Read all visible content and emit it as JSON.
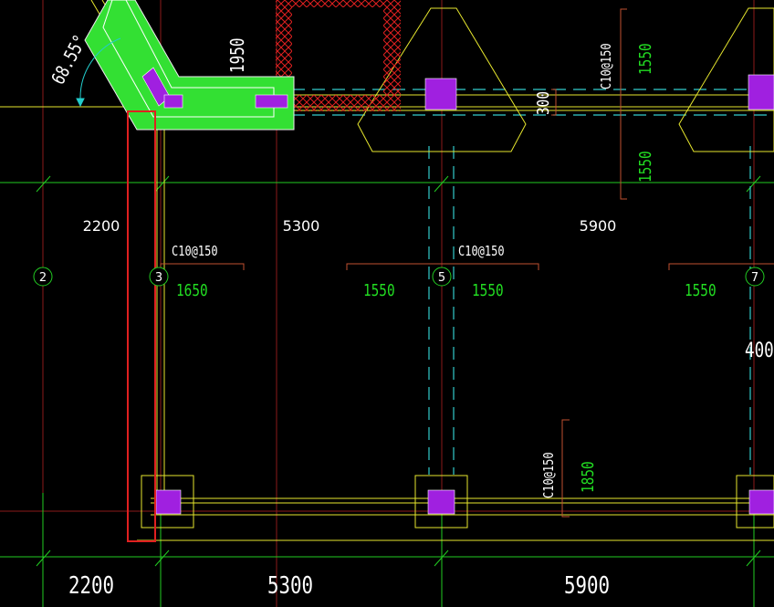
{
  "drawing": {
    "angle_label": "68.55°",
    "dims_top": {
      "d1950": "1950",
      "d300": "300",
      "d1550_upper": "1550",
      "d1550_lower": "1550"
    },
    "spans_upper": {
      "s1": "2200",
      "s2": "5300",
      "s3": "5900"
    },
    "spans_bottom": {
      "s1": "2200",
      "s2": "5300",
      "s3": "5900"
    },
    "rebar_labels": {
      "r1": "C10@150",
      "r2": "C10@150",
      "r3": "C10@150",
      "r4": "C10@150"
    },
    "green_dims": {
      "g1650": "1650",
      "g1550a": "1550",
      "g1550b": "1550",
      "g1550c": "1550",
      "g1850": "1850"
    },
    "side_dim": "400",
    "axes": {
      "a2": "2",
      "a3": "3",
      "a5": "5",
      "a7": "7"
    }
  }
}
